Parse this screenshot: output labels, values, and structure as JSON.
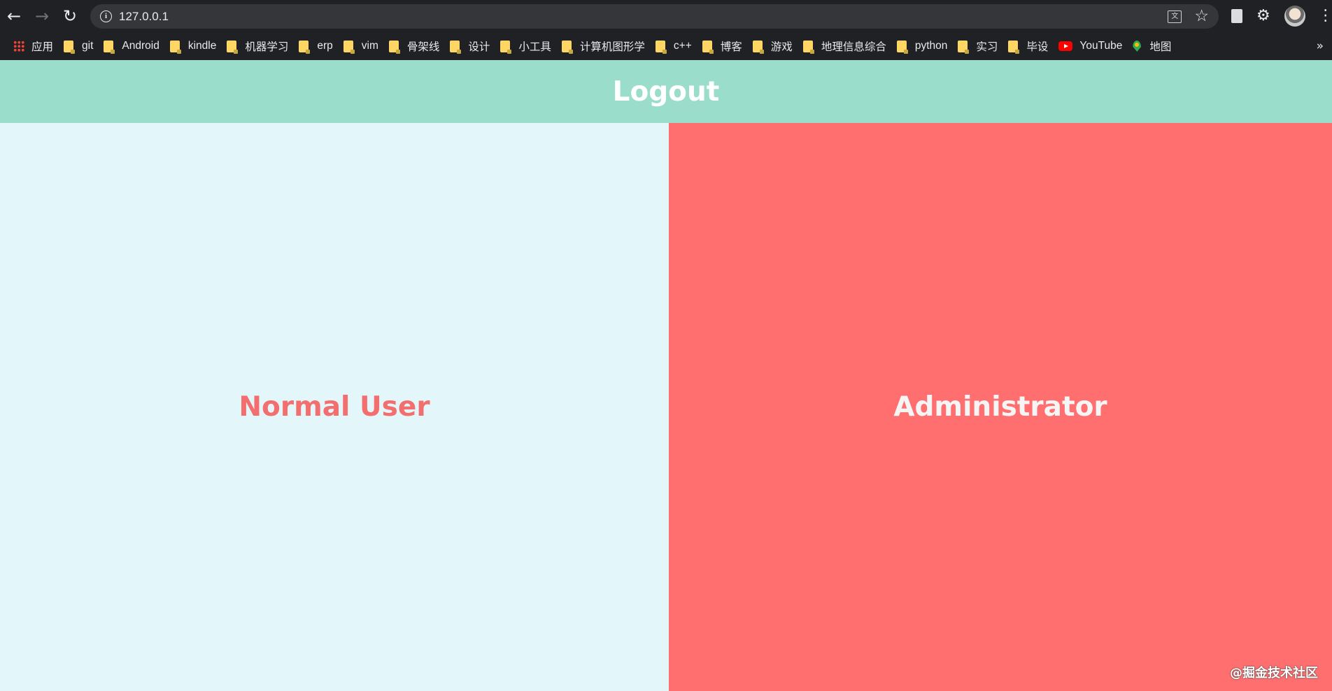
{
  "browser": {
    "url": "127.0.0.1",
    "bookmarks": [
      {
        "label": "应用",
        "icon": "apps-icon"
      },
      {
        "label": "git",
        "icon": "folder-icon"
      },
      {
        "label": "Android",
        "icon": "folder-icon"
      },
      {
        "label": "kindle",
        "icon": "folder-icon"
      },
      {
        "label": "机器学习",
        "icon": "folder-icon"
      },
      {
        "label": "erp",
        "icon": "folder-icon"
      },
      {
        "label": "vim",
        "icon": "folder-icon"
      },
      {
        "label": "骨架线",
        "icon": "folder-icon"
      },
      {
        "label": "设计",
        "icon": "folder-icon"
      },
      {
        "label": "小工具",
        "icon": "folder-icon"
      },
      {
        "label": "计算机图形学",
        "icon": "folder-icon"
      },
      {
        "label": "c++",
        "icon": "folder-icon"
      },
      {
        "label": "博客",
        "icon": "folder-icon"
      },
      {
        "label": "游戏",
        "icon": "folder-icon"
      },
      {
        "label": "地理信息综合",
        "icon": "folder-icon"
      },
      {
        "label": "python",
        "icon": "folder-icon"
      },
      {
        "label": "实习",
        "icon": "folder-icon"
      },
      {
        "label": "毕设",
        "icon": "folder-icon"
      },
      {
        "label": "YouTube",
        "icon": "youtube-icon"
      },
      {
        "label": "地图",
        "icon": "maps-icon"
      }
    ],
    "overflow_label": "»"
  },
  "header": {
    "logout_label": "Logout",
    "color": "#99ddca"
  },
  "panels": {
    "normal": {
      "label": "Normal User",
      "bg": "#e3f7fa",
      "text_color": "#f36f6f"
    },
    "admin": {
      "label": "Administrator",
      "bg": "#ff6f6f",
      "text_color": "#f5f5f5"
    }
  },
  "watermark": "@掘金技术社区"
}
